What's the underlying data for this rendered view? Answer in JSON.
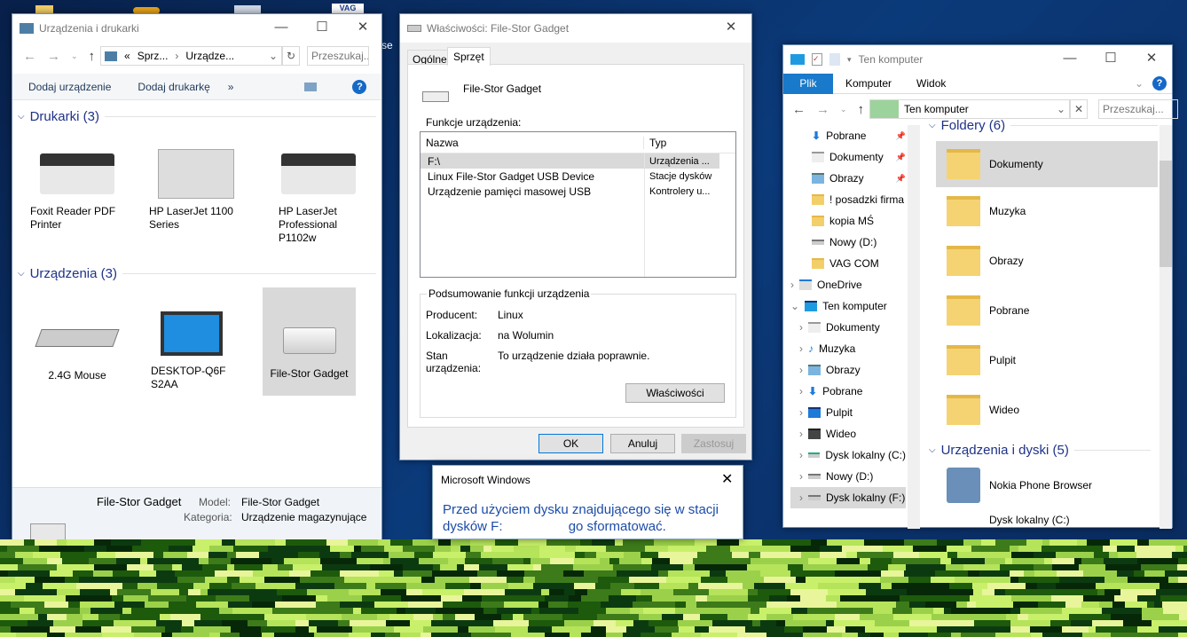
{
  "desktop": {
    "label_fragment": "se"
  },
  "devices_window": {
    "title": "Urządzenia i drukarki",
    "breadcrumb": [
      "«",
      "Sprz...",
      "Urządze..."
    ],
    "search_placeholder": "Przeszukaj...",
    "toolbar": {
      "add_device": "Dodaj urządzenie",
      "add_printer": "Dodaj drukarkę",
      "more": "»"
    },
    "printers_group": "Drukarki (3)",
    "printers": [
      "Foxit Reader PDF Printer",
      "HP LaserJet 1100 Series",
      "HP LaserJet Professional P1102w"
    ],
    "devices_group": "Urządzenia (3)",
    "devices": [
      "2.4G Mouse",
      "DESKTOP-Q6FS2AA",
      "File-Stor Gadget"
    ],
    "details": {
      "name": "File-Stor Gadget",
      "model_label": "Model:",
      "model": "File-Stor Gadget",
      "category_label": "Kategoria:",
      "category": "Urządzenie magazynujące"
    }
  },
  "props_window": {
    "title": "Właściwości: File-Stor Gadget",
    "tabs": [
      "Ogólne",
      "Sprzęt"
    ],
    "device_name": "File-Stor Gadget",
    "functions_label": "Funkcje urządzenia:",
    "columns": [
      "Nazwa",
      "Typ"
    ],
    "rows": [
      [
        "F:\\",
        "Urządzenia ..."
      ],
      [
        "Linux File-Stor Gadget USB Device",
        "Stacje dysków"
      ],
      [
        "Urządzenie pamięci masowej USB",
        "Kontrolery u..."
      ]
    ],
    "summary": {
      "title": "Podsumowanie funkcji urządzenia",
      "producer_label": "Producent:",
      "producer": "Linux",
      "location_label": "Lokalizacja:",
      "location": "na Wolumin",
      "status_label": "Stan urządzenia:",
      "status": "To urządzenie działa poprawnie.",
      "properties_button": "Właściwości"
    },
    "buttons": {
      "ok": "OK",
      "cancel": "Anuluj",
      "apply": "Zastosuj"
    }
  },
  "dialog": {
    "title": "Microsoft Windows",
    "message_line1": "Przed użyciem dysku znajdującego się w stacji",
    "message_line2": "dysków F:",
    "message_tail": "go sformatować."
  },
  "explorer": {
    "title": "Ten komputer",
    "ribbon_tabs": [
      "Plik",
      "Komputer",
      "Widok"
    ],
    "address": "Ten komputer",
    "search_placeholder": "Przeszukaj...",
    "quick": [
      "Pobrane",
      "Dokumenty",
      "Obrazy",
      "! posadzki firma",
      "kopia MŚ",
      "Nowy (D:)",
      "VAG COM"
    ],
    "onedrive": "OneDrive",
    "this_pc": "Ten komputer",
    "pc_items": [
      "Dokumenty",
      "Muzyka",
      "Obrazy",
      "Pobrane",
      "Pulpit",
      "Wideo",
      "Dysk lokalny (C:)",
      "Nowy (D:)",
      "Dysk lokalny (F:)"
    ],
    "folders_group": "Foldery (6)",
    "folders": [
      "Dokumenty",
      "Muzyka",
      "Obrazy",
      "Pobrane",
      "Pulpit",
      "Wideo"
    ],
    "drives_group": "Urządzenia i dyski (5)",
    "drives": [
      "Nokia Phone Browser",
      "Dysk lokalny (C:)"
    ]
  }
}
